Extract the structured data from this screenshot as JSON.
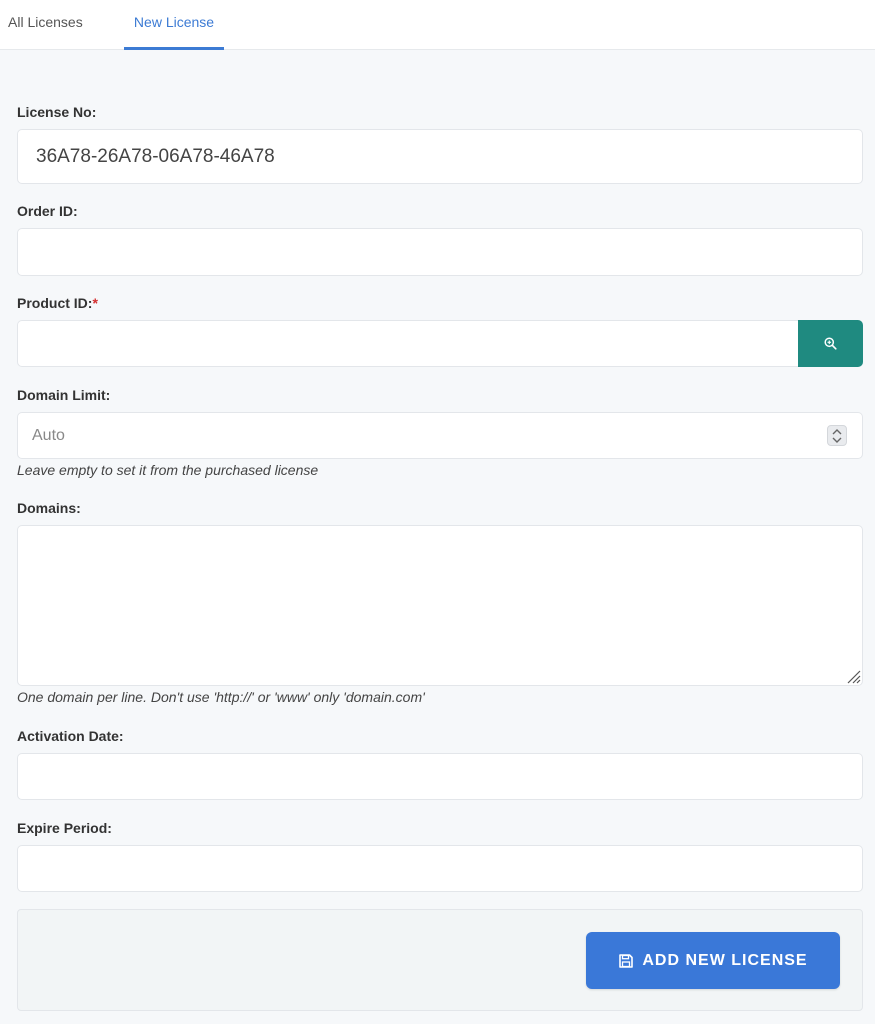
{
  "tabs": [
    {
      "label": "All Licenses",
      "active": false
    },
    {
      "label": "New License",
      "active": true
    }
  ],
  "form": {
    "license_no": {
      "label": "License No:",
      "value": "36A78-26A78-06A78-46A78"
    },
    "order_id": {
      "label": "Order ID:",
      "value": ""
    },
    "product_id": {
      "label": "Product ID:",
      "required_mark": "*",
      "value": "",
      "search_icon": "search-zoom-icon"
    },
    "domain_limit": {
      "label": "Domain Limit:",
      "placeholder": "Auto",
      "help": "Leave empty to set it from the purchased license"
    },
    "domains": {
      "label": "Domains:",
      "value": "",
      "help": "One domain per line. Don't use 'http://' or 'www' only 'domain.com'"
    },
    "activation_date": {
      "label": "Activation Date:",
      "value": ""
    },
    "expire_period": {
      "label": "Expire Period:",
      "value": ""
    }
  },
  "submit": {
    "label": "ADD NEW LICENSE",
    "icon": "save-icon"
  },
  "colors": {
    "accent": "#3c7bd4",
    "button": "#3a78d8",
    "search_button": "#1f8a80",
    "required": "#d32f2f"
  }
}
